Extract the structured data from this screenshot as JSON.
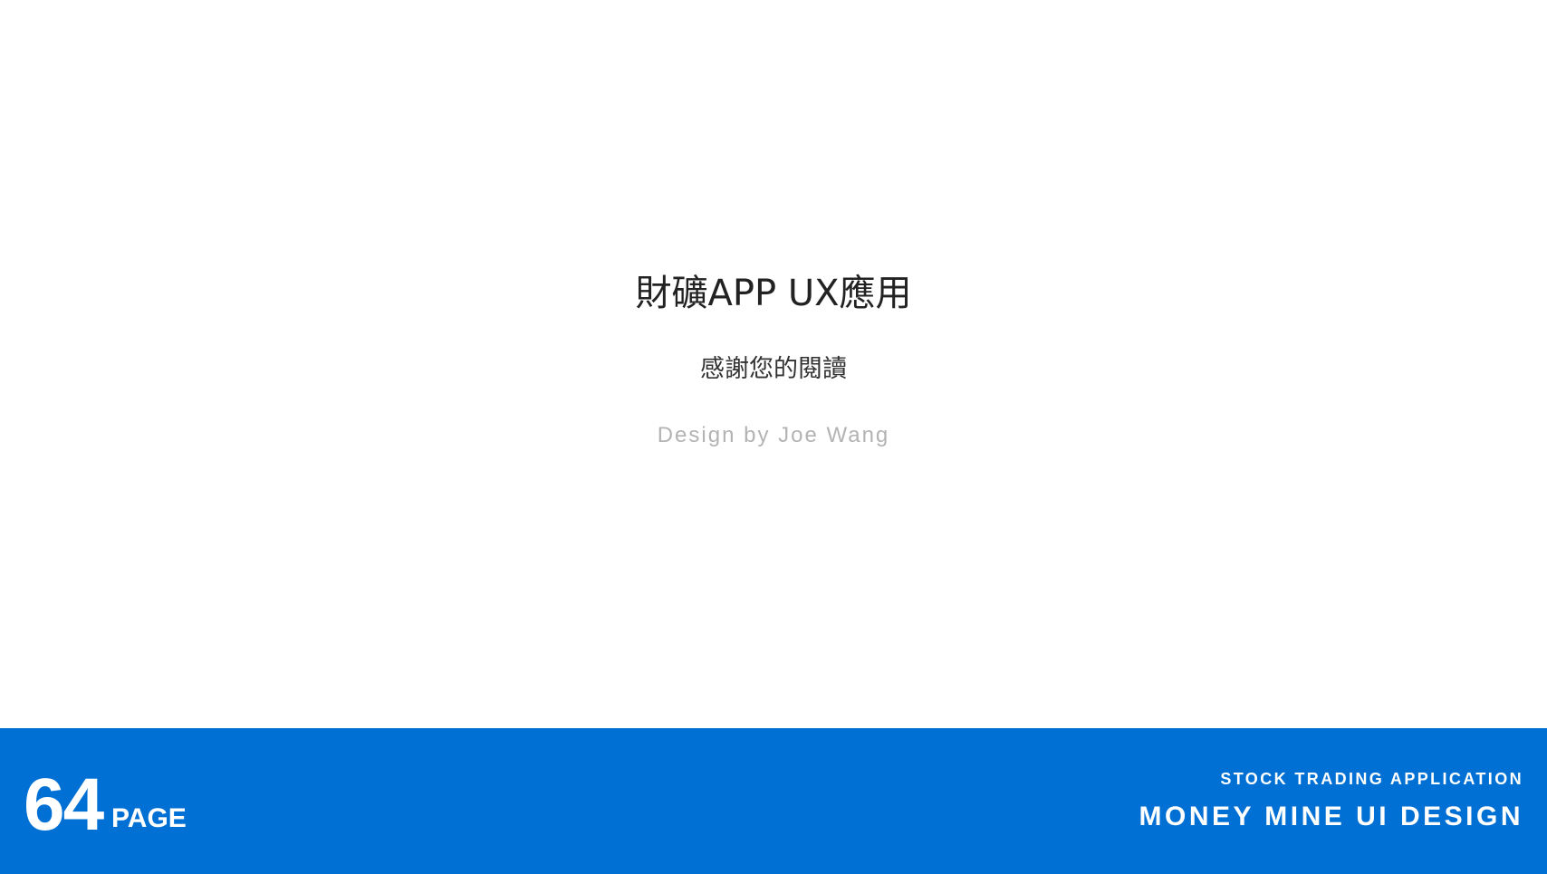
{
  "main": {
    "title": "財礦APP UX應用",
    "subtitle": "感謝您的閱讀",
    "credit": "Design by Joe Wang"
  },
  "footer": {
    "page_number": "64",
    "page_label": "PAGE",
    "kicker": "STOCK TRADING APPLICATION",
    "headline": "MONEY MINE UI DESIGN",
    "background_color": "#0070d4"
  }
}
